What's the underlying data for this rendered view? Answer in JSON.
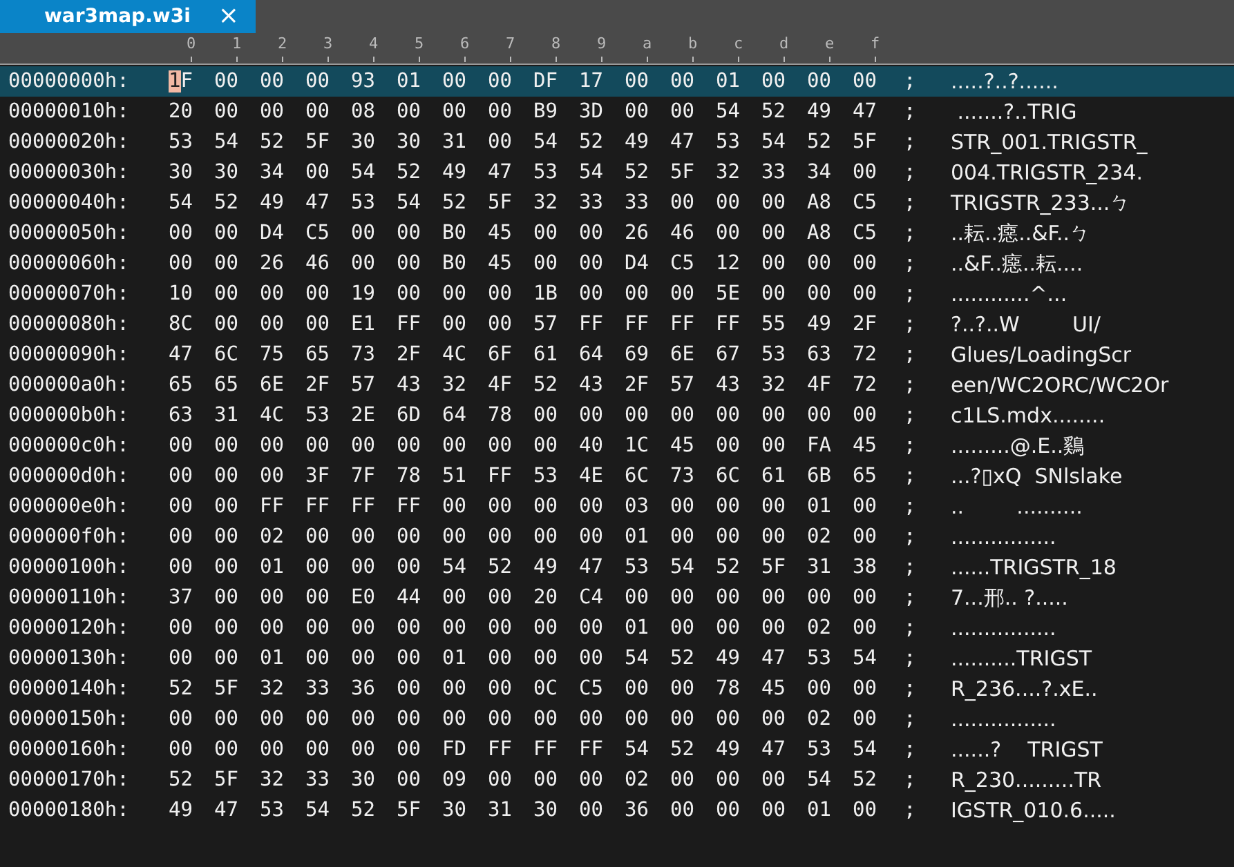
{
  "tab": {
    "title": "war3map.w3i",
    "close": "×",
    "selected": true
  },
  "columns": [
    "0",
    "1",
    "2",
    "3",
    "4",
    "5",
    "6",
    "7",
    "8",
    "9",
    "a",
    "b",
    "c",
    "d",
    "e",
    "f"
  ],
  "rows": [
    {
      "offset": "00000000h:",
      "hex": "1F 00 00 00 93 01 00 00 DF 17 00 00 01 00 00 00",
      "sep": ";",
      "ascii": ".....?..?......",
      "selected": true,
      "cursor": true
    },
    {
      "offset": "00000010h:",
      "hex": "20 00 00 00 08 00 00 00 B9 3D 00 00 54 52 49 47",
      "sep": ";",
      "ascii": " .......?..TRIG",
      "selected": false,
      "cursor": false
    },
    {
      "offset": "00000020h:",
      "hex": "53 54 52 5F 30 30 31 00 54 52 49 47 53 54 52 5F",
      "sep": ";",
      "ascii": "STR_001.TRIGSTR_",
      "selected": false,
      "cursor": false
    },
    {
      "offset": "00000030h:",
      "hex": "30 30 34 00 54 52 49 47 53 54 52 5F 32 33 34 00",
      "sep": ";",
      "ascii": "004.TRIGSTR_234.",
      "selected": false,
      "cursor": false
    },
    {
      "offset": "00000040h:",
      "hex": "54 52 49 47 53 54 52 5F 32 33 33 00 00 00 A8 C5",
      "sep": ";",
      "ascii": "TRIGSTR_233...ㄅ",
      "selected": false,
      "cursor": false
    },
    {
      "offset": "00000050h:",
      "hex": "00 00 D4 C5 00 00 B0 45 00 00 26 46 00 00 A8 C5",
      "sep": ";",
      "ascii": "..耘..癋..&F..ㄅ",
      "selected": false,
      "cursor": false
    },
    {
      "offset": "00000060h:",
      "hex": "00 00 26 46 00 00 B0 45 00 00 D4 C5 12 00 00 00",
      "sep": ";",
      "ascii": "..&F..癋..耘....",
      "selected": false,
      "cursor": false
    },
    {
      "offset": "00000070h:",
      "hex": "10 00 00 00 19 00 00 00 1B 00 00 00 5E 00 00 00",
      "sep": ";",
      "ascii": "............^...",
      "selected": false,
      "cursor": false
    },
    {
      "offset": "00000080h:",
      "hex": "8C 00 00 00 E1 FF 00 00 57 FF FF FF FF 55 49 2F",
      "sep": ";",
      "ascii": "?..?..W        UI/",
      "selected": false,
      "cursor": false
    },
    {
      "offset": "00000090h:",
      "hex": "47 6C 75 65 73 2F 4C 6F 61 64 69 6E 67 53 63 72",
      "sep": ";",
      "ascii": "Glues/LoadingScr",
      "selected": false,
      "cursor": false
    },
    {
      "offset": "000000a0h:",
      "hex": "65 65 6E 2F 57 43 32 4F 52 43 2F 57 43 32 4F 72",
      "sep": ";",
      "ascii": "een/WC2ORC/WC2Or",
      "selected": false,
      "cursor": false
    },
    {
      "offset": "000000b0h:",
      "hex": "63 31 4C 53 2E 6D 64 78 00 00 00 00 00 00 00 00",
      "sep": ";",
      "ascii": "c1LS.mdx........",
      "selected": false,
      "cursor": false
    },
    {
      "offset": "000000c0h:",
      "hex": "00 00 00 00 00 00 00 00 00 40 1C 45 00 00 FA 45",
      "sep": ";",
      "ascii": ".........@.E..鷄",
      "selected": false,
      "cursor": false
    },
    {
      "offset": "000000d0h:",
      "hex": "00 00 00 3F 7F 78 51 FF 53 4E 6C 73 6C 61 6B 65",
      "sep": ";",
      "ascii": "...?▯xQ  SNlslake",
      "selected": false,
      "cursor": false
    },
    {
      "offset": "000000e0h:",
      "hex": "00 00 FF FF FF FF 00 00 00 00 03 00 00 00 01 00",
      "sep": ";",
      "ascii": "..        ..........",
      "selected": false,
      "cursor": false
    },
    {
      "offset": "000000f0h:",
      "hex": "00 00 02 00 00 00 00 00 00 00 01 00 00 00 02 00",
      "sep": ";",
      "ascii": "................",
      "selected": false,
      "cursor": false
    },
    {
      "offset": "00000100h:",
      "hex": "00 00 01 00 00 00 54 52 49 47 53 54 52 5F 31 38",
      "sep": ";",
      "ascii": "......TRIGSTR_18",
      "selected": false,
      "cursor": false
    },
    {
      "offset": "00000110h:",
      "hex": "37 00 00 00 E0 44 00 00 20 C4 00 00 00 00 00 00",
      "sep": ";",
      "ascii": "7...邢.. ?.....",
      "selected": false,
      "cursor": false
    },
    {
      "offset": "00000120h:",
      "hex": "00 00 00 00 00 00 00 00 00 00 01 00 00 00 02 00",
      "sep": ";",
      "ascii": "................",
      "selected": false,
      "cursor": false
    },
    {
      "offset": "00000130h:",
      "hex": "00 00 01 00 00 00 01 00 00 00 54 52 49 47 53 54",
      "sep": ";",
      "ascii": "..........TRIGST",
      "selected": false,
      "cursor": false
    },
    {
      "offset": "00000140h:",
      "hex": "52 5F 32 33 36 00 00 00 0C C5 00 00 78 45 00 00",
      "sep": ";",
      "ascii": "R_236....?.xE..",
      "selected": false,
      "cursor": false
    },
    {
      "offset": "00000150h:",
      "hex": "00 00 00 00 00 00 00 00 00 00 00 00 00 00 02 00",
      "sep": ";",
      "ascii": "................",
      "selected": false,
      "cursor": false
    },
    {
      "offset": "00000160h:",
      "hex": "00 00 00 00 00 00 FD FF FF FF 54 52 49 47 53 54",
      "sep": ";",
      "ascii": "......?    TRIGST",
      "selected": false,
      "cursor": false
    },
    {
      "offset": "00000170h:",
      "hex": "52 5F 32 33 30 00 09 00 00 00 02 00 00 00 54 52",
      "sep": ";",
      "ascii": "R_230.........TR",
      "selected": false,
      "cursor": false
    },
    {
      "offset": "00000180h:",
      "hex": "49 47 53 54 52 5F 30 31 30 00 36 00 00 00 01 00",
      "sep": ";",
      "ascii": "IGSTR_010.6.....",
      "selected": false,
      "cursor": false
    }
  ]
}
